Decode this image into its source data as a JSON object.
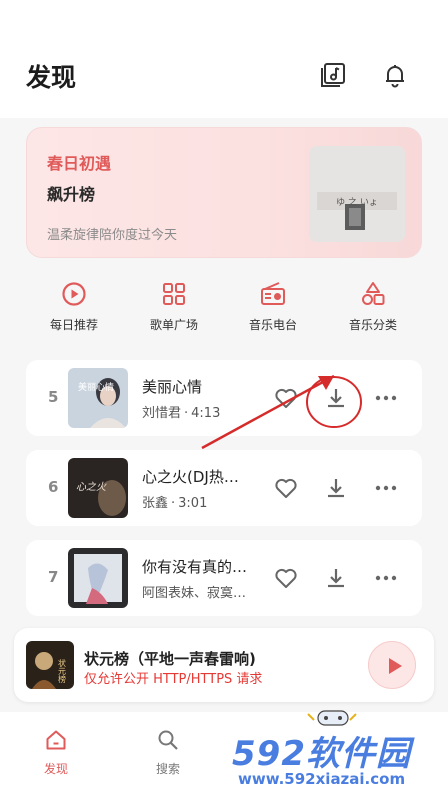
{
  "page": {
    "title": "发现"
  },
  "feature": {
    "title": "春日初遇",
    "subtitle": "飙升榜",
    "description": "温柔旋律陪你度过今天",
    "cover_text": "ゆ 之 いょ"
  },
  "categories": [
    {
      "label": "每日推荐",
      "icon": "play-circle-icon"
    },
    {
      "label": "歌单广场",
      "icon": "grid-icon"
    },
    {
      "label": "音乐电台",
      "icon": "radio-icon"
    },
    {
      "label": "音乐分类",
      "icon": "shapes-icon"
    }
  ],
  "songs": [
    {
      "rank": "5",
      "title": "美丽心情",
      "artist": "刘惜君",
      "duration": "4:13",
      "cover_text": "美丽心情"
    },
    {
      "rank": "6",
      "title": "心之火(DJ热…",
      "artist": "张鑫",
      "duration": "3:01",
      "cover_text": "心之火"
    },
    {
      "rank": "7",
      "title": "你有没有真的…",
      "artist": "阿图表妹、寂寞…",
      "duration": "",
      "cover_text": ""
    }
  ],
  "meta_separator": "·",
  "player": {
    "title": "状元榜（平地一声春雷响)",
    "warning": "仅允许公开 HTTP/HTTPS 请求",
    "cover_text": "状元榜"
  },
  "nav": [
    {
      "label": "发现",
      "icon": "home-icon",
      "active": true
    },
    {
      "label": "搜索",
      "icon": "search-icon",
      "active": false
    }
  ],
  "watermark": {
    "brand": "592软件园",
    "url": "www.592xiazai.com"
  },
  "colors": {
    "accent": "#e05a5a",
    "warning": "#e53935",
    "annotation": "#d62b2b",
    "watermark": "#4a7de0"
  }
}
